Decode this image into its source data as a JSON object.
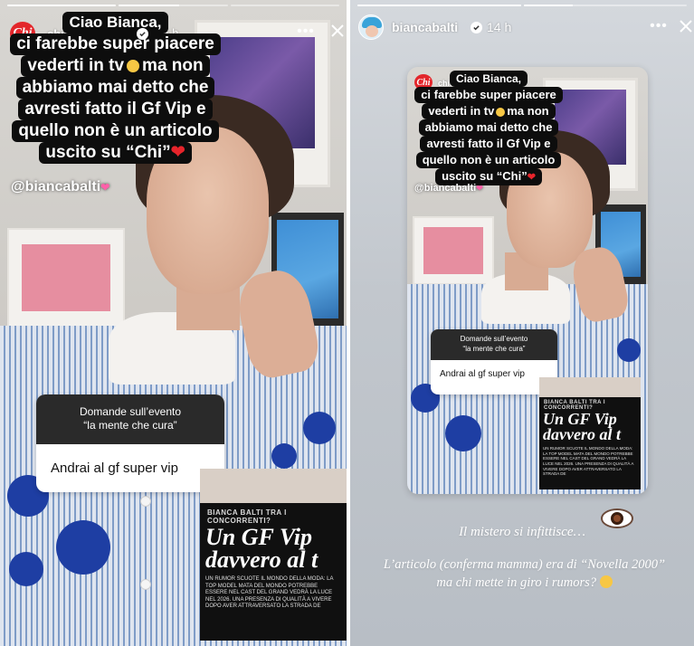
{
  "left_story": {
    "progress": [
      1,
      0.55,
      0
    ],
    "username": "chimagazineit",
    "verified_icon": "verified-badge-icon",
    "time": "15 h",
    "caption_lines": [
      "Ciao Bianca,",
      "ci farebbe super piacere",
      "vederti in tv",
      "ma non",
      "abbiamo mai detto che",
      "avresti fatto il Gf Vip e",
      "quello non è un articolo",
      "uscito su “Chi”"
    ],
    "mention": "@biancabalti",
    "question": {
      "title_line1": "Domande sull’evento",
      "title_line2": "“la mente che cura”",
      "answer": "Andrai al gf super vip"
    },
    "article": {
      "kicker": "BIANCA BALTI TRA I CONCORRENTI?",
      "headline_line1": "Un GF Vip",
      "headline_line2": "davvero al t",
      "body": "UN RUMOR SCUOTE IL MONDO DELLA MODA: LA TOP MODEL MATA DEL MONDO POTREBBE ESSERE NEL CAST DEL GRAND VEDRÀ LA LUCE NEL 2026. UNA PRESENZA DI QUALITÀ A VIVERE DOPO AVER ATTRAVERSATO LA STRADA DE"
    }
  },
  "right_story": {
    "progress": [
      1,
      0.3
    ],
    "username": "biancabalti",
    "verified_icon": "verified-badge-icon",
    "time": "14 h",
    "embedded": {
      "username": "chimagazineit",
      "caption_lines": [
        "Ciao Bianca,",
        "ci farebbe super piacere",
        "vederti in tv",
        "ma non",
        "abbiamo mai detto che",
        "avresti fatto il Gf Vip e",
        "quello non è un articolo",
        "uscito su “Chi”"
      ],
      "mention": "@biancabalti",
      "question_title_line1": "Domande sull’evento",
      "question_title_line2": "“la mente che cura”",
      "question_answer": "Andrai al gf super vip",
      "article_kicker": "BIANCA BALTI TRA I CONCORRENTI?",
      "article_headline_line1": "Un GF Vip",
      "article_headline_line2": "davvero al t",
      "article_body": "UN RUMOR SCUOTE IL MONDO DELLA MODA: LA TOP MODEL MATA DEL MONDO POTREBBE ESSERE NEL CAST DEL GRAND VEDRÀ LA LUCE NEL 2026. UNA PRESENZA DI QUALITÀ A VIVERE DOPO AVER ATTRAVERSATO LA STRADA DE"
    },
    "mystery_text": "Il mistero si infittisce…",
    "note_line1": "L’articolo (conferma mamma) era di “Novella 2000”",
    "note_line2": "ma chi mette in giro i rumors?"
  },
  "icons": {
    "menu": "more-icon",
    "close": "close-icon",
    "heart": "heart-emoji",
    "heart_eyes": "heart-eyes-emoji",
    "laughing": "laughing-emoji",
    "eye": "eye-emoji"
  },
  "colors": {
    "chi_brand": "#e3262b",
    "caption_bg": "#0d0d0d",
    "heart": "#e8242b"
  }
}
